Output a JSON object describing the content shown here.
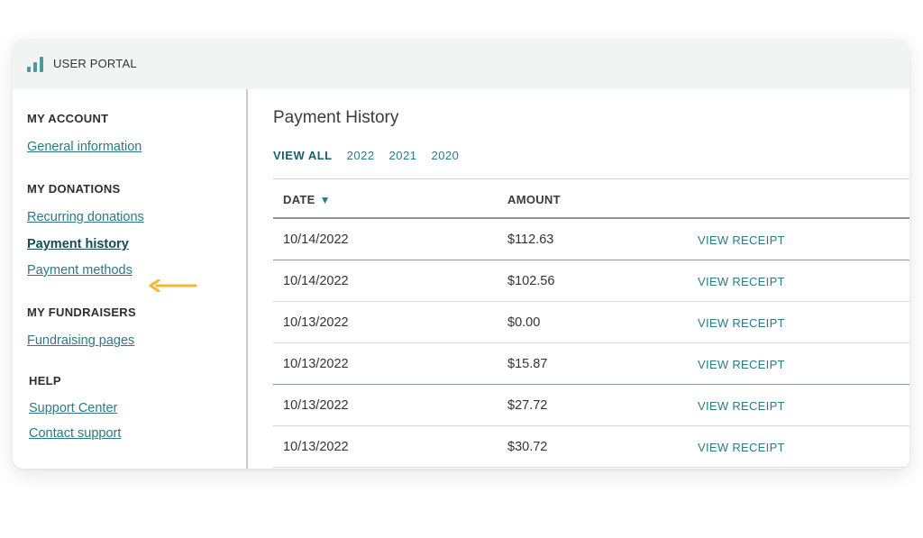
{
  "header": {
    "title": "USER PORTAL",
    "logo_icon": "bar-chart-icon"
  },
  "sidebar": {
    "sections": [
      {
        "heading": "MY ACCOUNT",
        "links": [
          "General information"
        ]
      },
      {
        "heading": "MY DONATIONS",
        "links": [
          "Recurring donations",
          "Payment history",
          "Payment methods"
        ]
      },
      {
        "heading": "MY FUNDRAISERS",
        "links": [
          "Fundraising pages"
        ]
      },
      {
        "heading": "HELP",
        "links": [
          "Support Center",
          "Contact support"
        ]
      }
    ],
    "active_link": "Payment history"
  },
  "main": {
    "title": "Payment History",
    "filters": [
      "VIEW ALL",
      "2022",
      "2021",
      "2020"
    ],
    "active_filter": "VIEW ALL",
    "columns": {
      "date": "DATE",
      "amount": "AMOUNT"
    },
    "sort_icon": "triangle-down-icon",
    "rows": [
      {
        "date": "10/14/2022",
        "amount": "$112.63",
        "action": "VIEW RECEIPT"
      },
      {
        "date": "10/14/2022",
        "amount": "$102.56",
        "action": "VIEW RECEIPT"
      },
      {
        "date": "10/13/2022",
        "amount": "$0.00",
        "action": "VIEW RECEIPT"
      },
      {
        "date": "10/13/2022",
        "amount": "$15.87",
        "action": "VIEW RECEIPT"
      },
      {
        "date": "10/13/2022",
        "amount": "$27.72",
        "action": "VIEW RECEIPT"
      },
      {
        "date": "10/13/2022",
        "amount": "$30.72",
        "action": "VIEW RECEIPT"
      }
    ]
  },
  "colors": {
    "accent": "#2c7a83",
    "active_link": "#134a54",
    "annotation_arrow": "#f5b731"
  }
}
